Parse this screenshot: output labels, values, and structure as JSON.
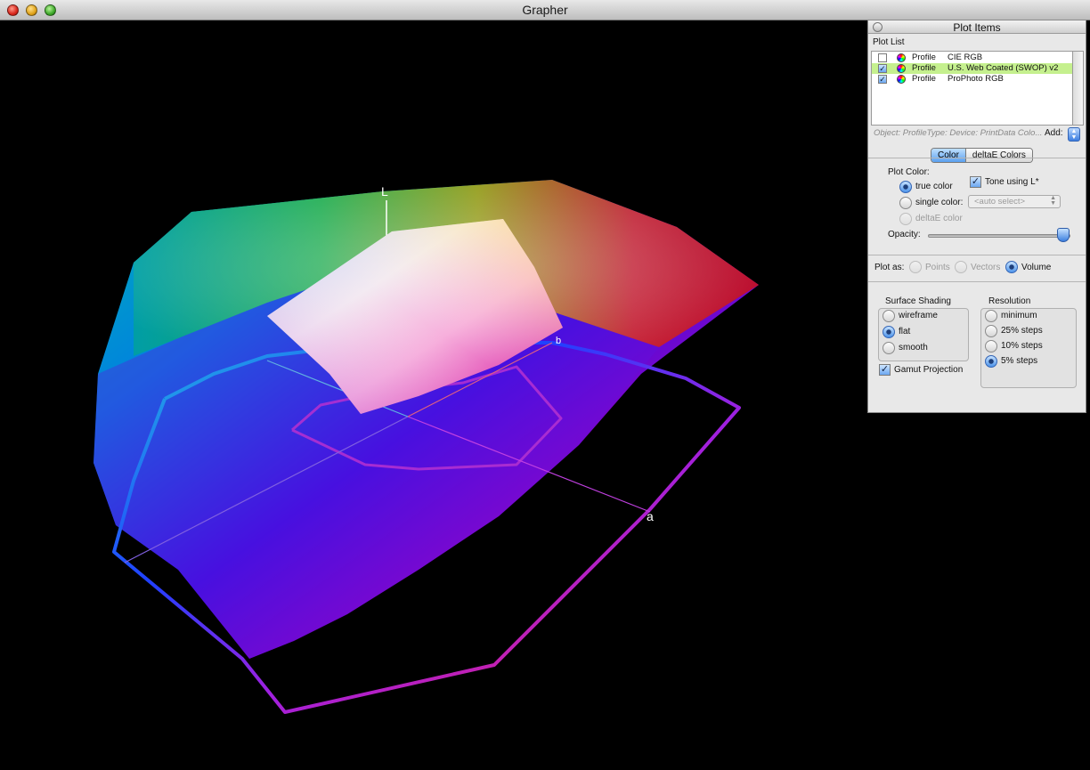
{
  "window": {
    "title": "Grapher"
  },
  "plot": {
    "axis_l": "L",
    "axis_a": "a",
    "axis_b": "b"
  },
  "panel": {
    "title": "Plot Items",
    "plot_list_label": "Plot List",
    "items": [
      {
        "checked": false,
        "type": "Profile",
        "name": "CIE RGB",
        "selected": false
      },
      {
        "checked": true,
        "type": "Profile",
        "name": "U.S. Web Coated (SWOP) v2",
        "selected": true
      },
      {
        "checked": true,
        "type": "Profile",
        "name": "ProPhoto RGB",
        "selected": false
      }
    ],
    "info_text": "Object: ProfileType: Device: PrintData Colo...",
    "add_label": "Add:",
    "tabs": [
      "Color",
      "deltaE Colors"
    ],
    "active_tab": "Color",
    "plot_color_label": "Plot Color:",
    "true_color": "true color",
    "single_color": "single color:",
    "deltae_color": "deltaE color",
    "tone_label": "Tone using L*",
    "auto_select": "<auto select>",
    "opacity_label": "Opacity:",
    "opacity": 0.95,
    "plot_as_label": "Plot as:",
    "plot_as": [
      "Points",
      "Vectors",
      "Volume"
    ],
    "plot_as_selected": "Volume",
    "surface_shading_label": "Surface Shading",
    "shading": [
      "wireframe",
      "flat",
      "smooth"
    ],
    "shading_selected": "flat",
    "resolution_label": "Resolution",
    "resolution": [
      "minimum",
      "25% steps",
      "10% steps",
      "5% steps"
    ],
    "resolution_selected": "5% steps",
    "gamut_projection": "Gamut Projection",
    "gamut_projection_checked": true
  }
}
